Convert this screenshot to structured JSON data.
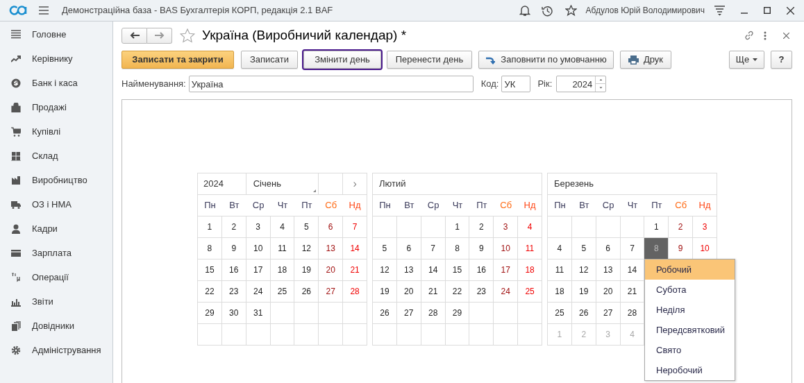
{
  "app_bar": {
    "title": "Демонстраційна база - BAS Бухгалтерія КОРП, редакція 2.1 BAF",
    "user": "Абдулов Юрій Володимирович"
  },
  "sidebar": {
    "items": [
      {
        "label": "Головне"
      },
      {
        "label": "Керівнику"
      },
      {
        "label": "Банк і каса"
      },
      {
        "label": "Продажі"
      },
      {
        "label": "Купівлі"
      },
      {
        "label": "Склад"
      },
      {
        "label": "Виробництво"
      },
      {
        "label": "ОЗ і НМА"
      },
      {
        "label": "Кадри"
      },
      {
        "label": "Зарплата"
      },
      {
        "label": "Операції"
      },
      {
        "label": "Звіти"
      },
      {
        "label": "Довідники"
      },
      {
        "label": "Адміністрування"
      }
    ]
  },
  "form": {
    "title": "Україна (Виробничий календар) *",
    "toolbar": {
      "save_close": {
        "label": "Записати та закрити"
      },
      "save": {
        "label": "Записати"
      },
      "change_day": {
        "label": "Змінити день",
        "focused": true
      },
      "move_day": {
        "label": "Перенести день"
      },
      "fill_default": {
        "label": "Заповнити по умовчанню"
      },
      "print": {
        "label": "Друк"
      },
      "more": {
        "label": "Ще"
      },
      "help": {
        "label": "?"
      }
    },
    "fields": {
      "name": {
        "label": "Найменування:",
        "value": "Україна"
      },
      "code": {
        "label": "Код:",
        "value": "УК"
      },
      "year": {
        "label": "Рік:",
        "value": "2024"
      }
    },
    "calendar": {
      "months": [
        {
          "year": "2024",
          "name": "Січень",
          "next": "›",
          "weekdays": [
            {
              "label": "Пн",
              "kind": "weekday"
            },
            {
              "label": "Вт",
              "kind": "weekday"
            },
            {
              "label": "Ср",
              "kind": "weekday"
            },
            {
              "label": "Чт",
              "kind": "weekday"
            },
            {
              "label": "Пт",
              "kind": "weekday"
            },
            {
              "label": "Сб",
              "kind": "saturday"
            },
            {
              "label": "Нд",
              "kind": "sunday"
            }
          ],
          "weeks": [
            [
              {
                "day": "1",
                "kind": "work",
                "selected": false
              },
              {
                "day": "2",
                "kind": "work",
                "selected": false
              },
              {
                "day": "3",
                "kind": "work",
                "selected": false
              },
              {
                "day": "4",
                "kind": "work",
                "selected": false
              },
              {
                "day": "5",
                "kind": "work",
                "selected": false
              },
              {
                "day": "6",
                "kind": "saturday",
                "selected": false
              },
              {
                "day": "7",
                "kind": "sunday",
                "selected": false
              }
            ],
            [
              {
                "day": "8",
                "kind": "work",
                "selected": false
              },
              {
                "day": "9",
                "kind": "work",
                "selected": false
              },
              {
                "day": "10",
                "kind": "work",
                "selected": false
              },
              {
                "day": "11",
                "kind": "work",
                "selected": false
              },
              {
                "day": "12",
                "kind": "work",
                "selected": false
              },
              {
                "day": "13",
                "kind": "saturday",
                "selected": false
              },
              {
                "day": "14",
                "kind": "sunday",
                "selected": false
              }
            ],
            [
              {
                "day": "15",
                "kind": "work",
                "selected": false
              },
              {
                "day": "16",
                "kind": "work",
                "selected": false
              },
              {
                "day": "17",
                "kind": "work",
                "selected": false
              },
              {
                "day": "18",
                "kind": "work",
                "selected": false
              },
              {
                "day": "19",
                "kind": "work",
                "selected": false
              },
              {
                "day": "20",
                "kind": "saturday",
                "selected": false
              },
              {
                "day": "21",
                "kind": "sunday",
                "selected": false
              }
            ],
            [
              {
                "day": "22",
                "kind": "work",
                "selected": false
              },
              {
                "day": "23",
                "kind": "work",
                "selected": false
              },
              {
                "day": "24",
                "kind": "work",
                "selected": false
              },
              {
                "day": "25",
                "kind": "work",
                "selected": false
              },
              {
                "day": "26",
                "kind": "work",
                "selected": false
              },
              {
                "day": "27",
                "kind": "saturday",
                "selected": false
              },
              {
                "day": "28",
                "kind": "sunday",
                "selected": false
              }
            ],
            [
              {
                "day": "29",
                "kind": "work",
                "selected": false
              },
              {
                "day": "30",
                "kind": "work",
                "selected": false
              },
              {
                "day": "31",
                "kind": "work",
                "selected": false
              },
              {
                "kind": "empty"
              },
              {
                "kind": "empty"
              },
              {
                "kind": "empty"
              },
              {
                "kind": "empty"
              }
            ],
            [
              {
                "kind": "empty"
              },
              {
                "kind": "empty"
              },
              {
                "kind": "empty"
              },
              {
                "kind": "empty"
              },
              {
                "kind": "empty"
              },
              {
                "kind": "empty"
              },
              {
                "kind": "empty"
              }
            ]
          ]
        },
        {
          "name": "Лютий",
          "weekdays": [
            {
              "label": "Пн",
              "kind": "weekday"
            },
            {
              "label": "Вт",
              "kind": "weekday"
            },
            {
              "label": "Ср",
              "kind": "weekday"
            },
            {
              "label": "Чт",
              "kind": "weekday"
            },
            {
              "label": "Пт",
              "kind": "weekday"
            },
            {
              "label": "Сб",
              "kind": "saturday"
            },
            {
              "label": "Нд",
              "kind": "sunday"
            }
          ],
          "weeks": [
            [
              {
                "kind": "empty"
              },
              {
                "kind": "empty"
              },
              {
                "kind": "empty"
              },
              {
                "day": "1",
                "kind": "work",
                "selected": false
              },
              {
                "day": "2",
                "kind": "work",
                "selected": false
              },
              {
                "day": "3",
                "kind": "saturday",
                "selected": false
              },
              {
                "day": "4",
                "kind": "sunday",
                "selected": false
              }
            ],
            [
              {
                "day": "5",
                "kind": "work",
                "selected": false
              },
              {
                "day": "6",
                "kind": "work",
                "selected": false
              },
              {
                "day": "7",
                "kind": "work",
                "selected": false
              },
              {
                "day": "8",
                "kind": "work",
                "selected": false
              },
              {
                "day": "9",
                "kind": "work",
                "selected": false
              },
              {
                "day": "10",
                "kind": "saturday",
                "selected": false
              },
              {
                "day": "11",
                "kind": "sunday",
                "selected": false
              }
            ],
            [
              {
                "day": "12",
                "kind": "work",
                "selected": false
              },
              {
                "day": "13",
                "kind": "work",
                "selected": false
              },
              {
                "day": "14",
                "kind": "work",
                "selected": false
              },
              {
                "day": "15",
                "kind": "work",
                "selected": false
              },
              {
                "day": "16",
                "kind": "work",
                "selected": false
              },
              {
                "day": "17",
                "kind": "saturday",
                "selected": false
              },
              {
                "day": "18",
                "kind": "sunday",
                "selected": false
              }
            ],
            [
              {
                "day": "19",
                "kind": "work",
                "selected": false
              },
              {
                "day": "20",
                "kind": "work",
                "selected": false
              },
              {
                "day": "21",
                "kind": "work",
                "selected": false
              },
              {
                "day": "22",
                "kind": "work",
                "selected": false
              },
              {
                "day": "23",
                "kind": "work",
                "selected": false
              },
              {
                "day": "24",
                "kind": "saturday",
                "selected": false
              },
              {
                "day": "25",
                "kind": "sunday",
                "selected": false
              }
            ],
            [
              {
                "day": "26",
                "kind": "work",
                "selected": false
              },
              {
                "day": "27",
                "kind": "work",
                "selected": false
              },
              {
                "day": "28",
                "kind": "work",
                "selected": false
              },
              {
                "day": "29",
                "kind": "work",
                "selected": false
              },
              {
                "kind": "empty"
              },
              {
                "kind": "empty"
              },
              {
                "kind": "empty"
              }
            ],
            [
              {
                "kind": "empty"
              },
              {
                "kind": "empty"
              },
              {
                "kind": "empty"
              },
              {
                "kind": "empty"
              },
              {
                "kind": "empty"
              },
              {
                "kind": "empty"
              },
              {
                "kind": "empty"
              }
            ]
          ]
        },
        {
          "name": "Березень",
          "weekdays": [
            {
              "label": "Пн",
              "kind": "weekday"
            },
            {
              "label": "Вт",
              "kind": "weekday"
            },
            {
              "label": "Ср",
              "kind": "weekday"
            },
            {
              "label": "Чт",
              "kind": "weekday"
            },
            {
              "label": "Пт",
              "kind": "weekday"
            },
            {
              "label": "Сб",
              "kind": "saturday"
            },
            {
              "label": "Нд",
              "kind": "sunday"
            }
          ],
          "weeks": [
            [
              {
                "kind": "empty"
              },
              {
                "kind": "empty"
              },
              {
                "kind": "empty"
              },
              {
                "kind": "empty"
              },
              {
                "day": "1",
                "kind": "work",
                "selected": false
              },
              {
                "day": "2",
                "kind": "saturday",
                "selected": false
              },
              {
                "day": "3",
                "kind": "sunday",
                "selected": false
              }
            ],
            [
              {
                "day": "4",
                "kind": "work",
                "selected": false
              },
              {
                "day": "5",
                "kind": "work",
                "selected": false
              },
              {
                "day": "6",
                "kind": "work",
                "selected": false
              },
              {
                "day": "7",
                "kind": "work",
                "selected": false
              },
              {
                "day": "8",
                "kind": "work",
                "selected": true
              },
              {
                "day": "9",
                "kind": "saturday",
                "selected": false
              },
              {
                "day": "10",
                "kind": "sunday",
                "selected": false
              }
            ],
            [
              {
                "day": "11",
                "kind": "work",
                "selected": false
              },
              {
                "day": "12",
                "kind": "work",
                "selected": false
              },
              {
                "day": "13",
                "kind": "work",
                "selected": false
              },
              {
                "day": "14",
                "kind": "work",
                "selected": false
              }
            ],
            [
              {
                "day": "18",
                "kind": "work",
                "selected": false
              },
              {
                "day": "19",
                "kind": "work",
                "selected": false
              },
              {
                "day": "20",
                "kind": "work",
                "selected": false
              },
              {
                "day": "21",
                "kind": "work",
                "selected": false
              }
            ],
            [
              {
                "day": "25",
                "kind": "work",
                "selected": false
              },
              {
                "day": "26",
                "kind": "work",
                "selected": false
              },
              {
                "day": "27",
                "kind": "work",
                "selected": false
              },
              {
                "day": "28",
                "kind": "work",
                "selected": false
              }
            ],
            [
              {
                "day": "1",
                "kind": "other_month",
                "selected": false
              },
              {
                "day": "2",
                "kind": "other_month",
                "selected": false
              },
              {
                "day": "3",
                "kind": "other_month",
                "selected": false
              },
              {
                "day": "4",
                "kind": "other_month",
                "selected": false
              }
            ]
          ]
        }
      ],
      "day_menu": {
        "items": [
          {
            "label": "Робочий",
            "selected": true
          },
          {
            "label": "Субота",
            "selected": false
          },
          {
            "label": "Неділя",
            "selected": false
          },
          {
            "label": "Передсвятковий",
            "selected": false
          },
          {
            "label": "Свято",
            "selected": false
          },
          {
            "label": "Неробочий",
            "selected": false
          }
        ]
      }
    }
  }
}
